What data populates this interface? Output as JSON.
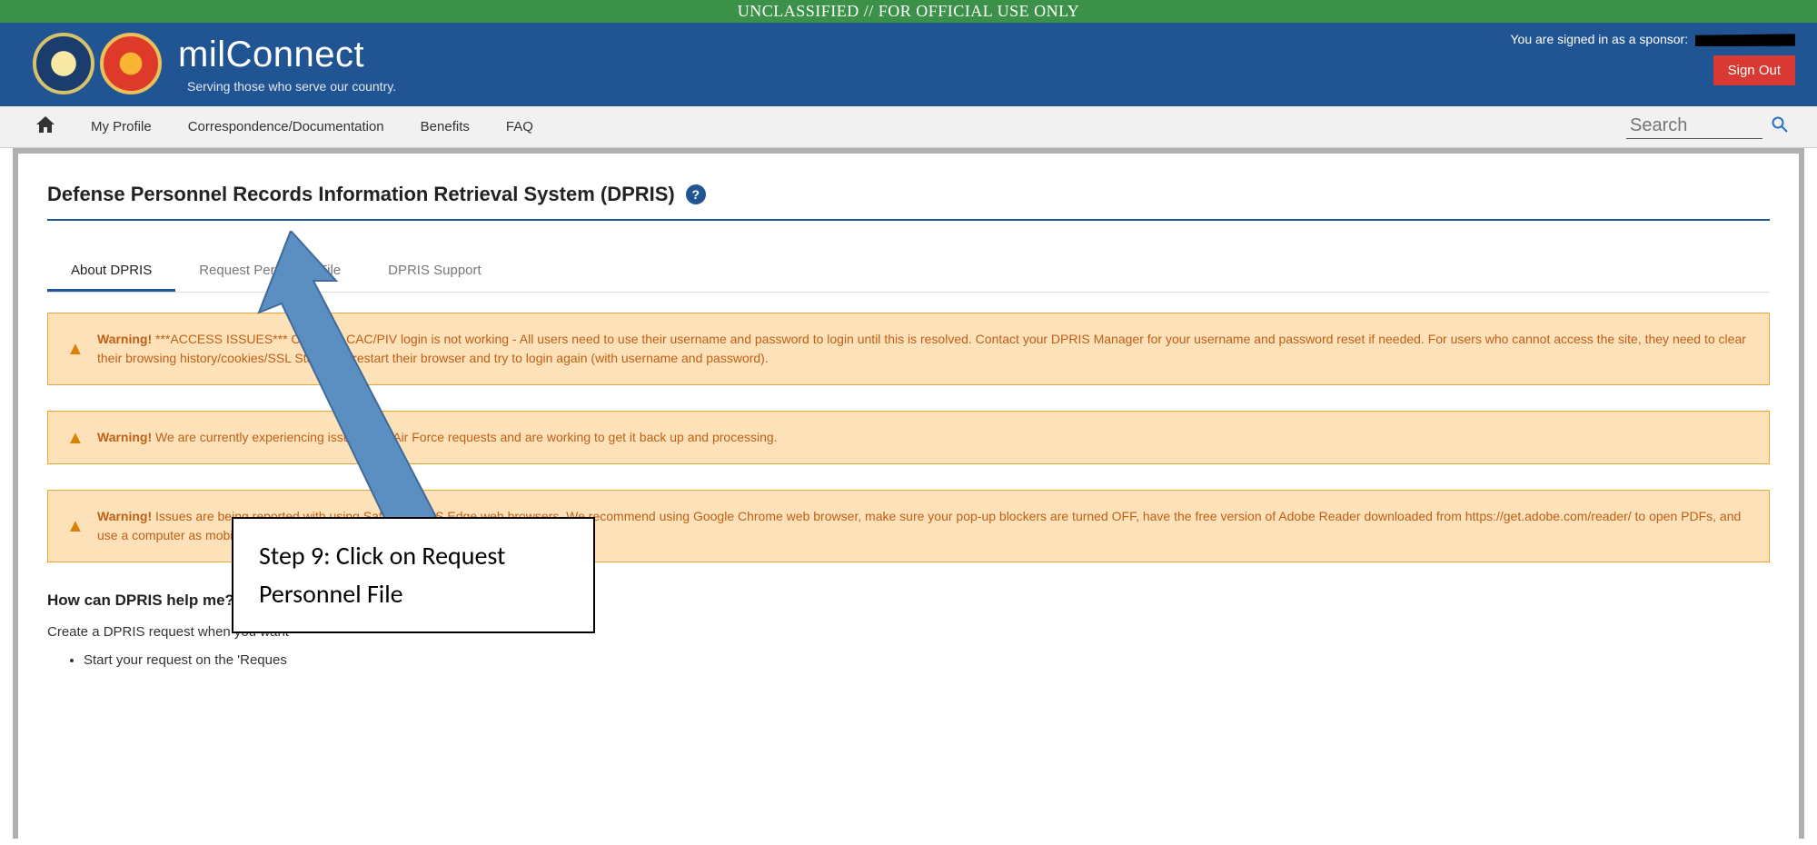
{
  "classification": "UNCLASSIFIED // FOR OFFICIAL USE ONLY",
  "brand": {
    "title": "milConnect",
    "subtitle": "Serving those who serve our country."
  },
  "header": {
    "signed_in_text": "You are signed in as a sponsor:",
    "signout": "Sign Out"
  },
  "nav": {
    "profile": "My Profile",
    "correspondence": "Correspondence/Documentation",
    "benefits": "Benefits",
    "faq": "FAQ",
    "search_placeholder": "Search"
  },
  "page": {
    "title": "Defense Personnel Records Information Retrieval System (DPRIS)"
  },
  "tabs": {
    "about": "About DPRIS",
    "request": "Request Personnel File",
    "support": "DPRIS Support"
  },
  "alerts": [
    {
      "prefix": "Warning!",
      "text": " ***ACCESS ISSUES*** Currently CAC/PIV login is not working - All users need to use their username and password to login until this is resolved. Contact your DPRIS Manager for your username and password reset if needed. For users who cannot access the site, they need to clear their browsing history/cookies/SSL State and restart their browser and try to login again (with username and password)."
    },
    {
      "prefix": "Warning!",
      "text": " We are currently experiencing issues with Air Force requests and are working to get it back up and processing."
    },
    {
      "prefix": "Warning!",
      "text": " Issues are being reported with using Safari and MS Edge web browsers. We recommend using Google Chrome web browser, make sure your pop-up blockers are turned OFF, have the free version of Adobe Reader downloaded from https://get.adobe.com/reader/ to open PDFs, and use a computer as mobile devices are not currently supported."
    }
  ],
  "howcan": {
    "title": "How can DPRIS help me?",
    "subtitle": "Create a DPRIS request when you want",
    "item1": "Start your request on the 'Reques"
  },
  "callout": "Step 9: Click on Request Personnel File"
}
